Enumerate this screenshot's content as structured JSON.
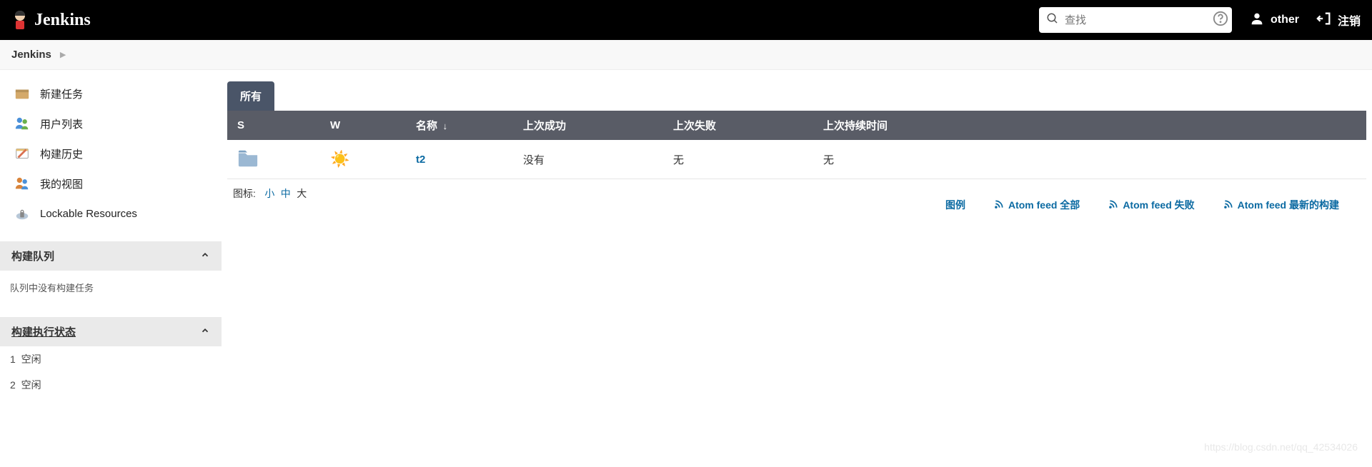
{
  "header": {
    "brand": "Jenkins",
    "search_placeholder": "查找",
    "user": "other",
    "logout": "注销"
  },
  "breadcrumbs": {
    "items": [
      "Jenkins"
    ]
  },
  "sidebar": {
    "links": [
      {
        "label": "新建任务"
      },
      {
        "label": "用户列表"
      },
      {
        "label": "构建历史"
      },
      {
        "label": "我的视图"
      },
      {
        "label": "Lockable Resources"
      }
    ],
    "queue": {
      "title": "构建队列",
      "empty": "队列中没有构建任务"
    },
    "exec": {
      "title": "构建执行状态",
      "items": [
        {
          "num": "1",
          "state": "空闲"
        },
        {
          "num": "2",
          "state": "空闲"
        }
      ]
    }
  },
  "main": {
    "tab": "所有",
    "columns": {
      "s": "S",
      "w": "W",
      "name": "名称",
      "last_success": "上次成功",
      "last_fail": "上次失败",
      "last_duration": "上次持续时间"
    },
    "rows": [
      {
        "name": "t2",
        "last_success": "没有",
        "last_fail": "无",
        "last_duration": "无"
      }
    ],
    "icon_size": {
      "label": "图标:",
      "small": "小",
      "medium": "中",
      "large": "大"
    },
    "feeds": {
      "legend": "图例",
      "all": "Atom feed 全部",
      "fail": "Atom feed 失败",
      "latest": "Atom feed 最新的构建"
    }
  },
  "watermark": "https://blog.csdn.net/qq_42534026"
}
